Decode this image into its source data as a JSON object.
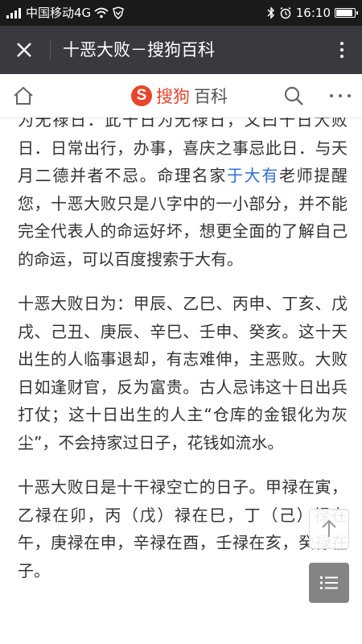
{
  "status_bar": {
    "carrier": "中国移动4G",
    "time": "16:10",
    "battery_level": 0.9
  },
  "title_bar": {
    "title": "十恶大败－搜狗百科",
    "close_icon": "close-icon",
    "more_icon": "vertical-dots-icon"
  },
  "site_header": {
    "brand_logo_letter": "S",
    "brand_sougou": "搜狗",
    "brand_baike": "百科",
    "home_icon": "home-icon",
    "search_icon": "search-icon",
    "menu_icon": "horizontal-dots-icon",
    "brand_color": "#e8452b"
  },
  "article": {
    "p1": {
      "text_before_link": "为无禄日．此十日为无禄日，又曰十日大败日．日常出行，办事，喜庆之事忌此日．与天月二德并者不忌。命理名家",
      "link": "于大有",
      "text_after_link": "老师提醒您，十恶大败只是八字中的一小部分，并不能完全代表人的命运好坏，想更全面的了解自己的命运，可以百度搜索于大有。"
    },
    "p2": "十恶大败日为：甲辰、乙巳、丙申、丁亥、戊戌、己丑、庚辰、辛巳、壬申、癸亥。这十天出生的人临事退却，有志难伸，主恶败。大败日如逢财官，反为富贵。古人忌讳这十日出兵打仗；这十日出生的人主“仓库的金银化为灰尘”，不会持家过日子，花钱如流水。",
    "p3": "十恶大败日是十干禄空亡的日子。甲禄在寅，乙禄在卯，丙（戊）禄在巳，丁（己）禄在午，庚禄在申，辛禄在酉，壬禄在亥，癸禄在子。",
    "link_color": "#2e6fd6"
  },
  "floating": {
    "back_to_top_icon": "arrow-up-icon",
    "toc_icon": "list-icon"
  }
}
